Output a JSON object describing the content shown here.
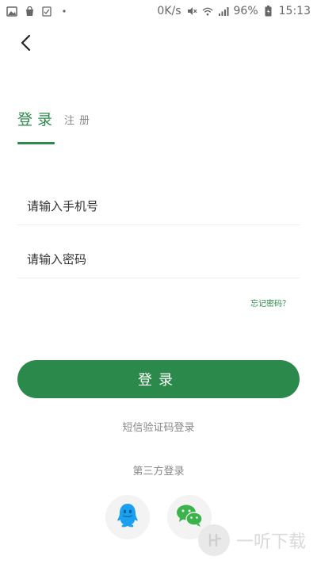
{
  "status_bar": {
    "network_speed": "0K/s",
    "battery": "96%",
    "time": "15:13",
    "icons_left": [
      "image-icon",
      "bag-icon",
      "checklist-icon",
      "dot-icon"
    ],
    "icons_right": [
      "mute-icon",
      "wifi-icon",
      "signal-icon",
      "battery-icon"
    ]
  },
  "header": {
    "back_icon": "chevron-left-icon"
  },
  "tabs": {
    "login": "登录",
    "register": "注册"
  },
  "form": {
    "phone_placeholder": "请输入手机号",
    "password_placeholder": "请输入密码",
    "forgot_password": "忘记密码？",
    "login_button": "登录"
  },
  "alt_login": {
    "sms_login": "短信验证码登录",
    "third_party_title": "第三方登录",
    "providers": [
      "qq-icon",
      "wechat-icon"
    ]
  },
  "watermark": {
    "text": "一听下载"
  },
  "colors": {
    "accent": "#2b8a4b",
    "muted_text": "#888888",
    "divider": "#eeeeee",
    "qq_blue": "#1aa0f0",
    "wechat_green": "#3cb34a"
  }
}
